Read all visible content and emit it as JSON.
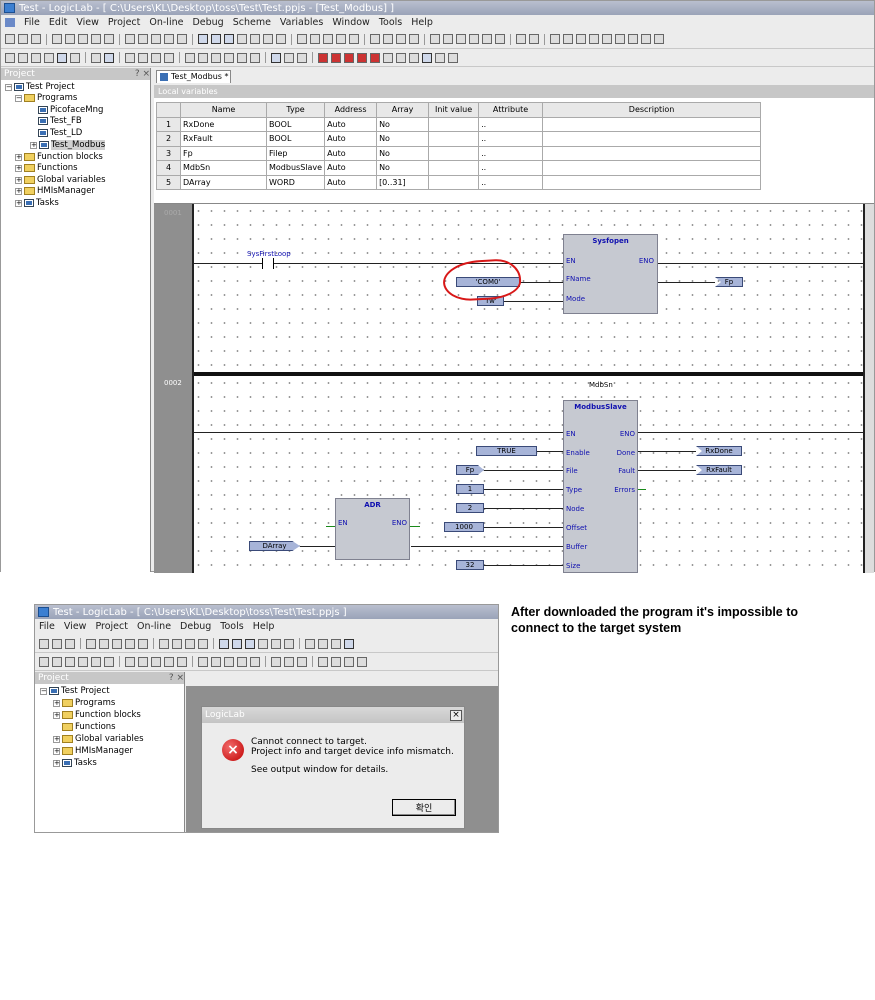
{
  "window1": {
    "title": "Test - LogicLab - [ C:\\Users\\KL\\Desktop\\toss\\Test\\Test.ppjs - [Test_Modbus] ]",
    "menu": [
      "File",
      "Edit",
      "View",
      "Project",
      "On-line",
      "Debug",
      "Scheme",
      "Variables",
      "Window",
      "Tools",
      "Help"
    ],
    "tab_label": "Test_Modbus *",
    "tree": {
      "header": "Project",
      "header_btns": "? ×",
      "items": [
        "Test Project",
        "Programs",
        "PicofaceMng",
        "Test_FB",
        "Test_LD",
        "Test_Modbus",
        "Function blocks",
        "Functions",
        "Global variables",
        "HMIsManager",
        "Tasks"
      ]
    },
    "vars_header_label": "Local variables",
    "vars_table": {
      "columns": [
        "",
        "Name",
        "Type",
        "Address",
        "Array",
        "Init value",
        "Attribute",
        "Description"
      ],
      "rows": [
        [
          "1",
          "RxDone",
          "BOOL",
          "Auto",
          "No",
          "",
          "..",
          ""
        ],
        [
          "2",
          "RxFault",
          "BOOL",
          "Auto",
          "No",
          "",
          "..",
          ""
        ],
        [
          "3",
          "Fp",
          "Filep",
          "Auto",
          "No",
          "",
          "..",
          ""
        ],
        [
          "4",
          "MdbSn",
          "ModbusSlave",
          "Auto",
          "No",
          "",
          "..",
          ""
        ],
        [
          "5",
          "DArray",
          "WORD",
          "Auto",
          "[0..31]",
          "",
          "..",
          ""
        ]
      ]
    },
    "network1": {
      "number": "0001",
      "contact_label": "SysFirstLoop",
      "block_title": "Sysfopen",
      "pins_left": [
        "EN",
        "FName",
        "Mode"
      ],
      "pins_right": [
        "ENO"
      ],
      "in_fname": "'COM0'",
      "in_mode": "'rw'",
      "out": "Fp",
      "highlight_color": "#d81818"
    },
    "network2": {
      "number": "0002",
      "instance": "MdbSn",
      "block_title": "ModbusSlave",
      "pins_left": [
        "EN",
        "Enable",
        "File",
        "Type",
        "Node",
        "Offset",
        "Buffer",
        "Size"
      ],
      "pins_right": [
        "ENO",
        "Done",
        "Fault",
        "Errors"
      ],
      "inputs": [
        "TRUE",
        "Fp",
        "1",
        "2",
        "1000",
        "32"
      ],
      "outputs": [
        "RxDone",
        "RxFault"
      ],
      "adr_title": "ADR",
      "adr_pins": [
        "EN",
        "ENO"
      ],
      "adr_in": "DArray"
    }
  },
  "caption": "After downloaded the program it's impossible to connect to the target system",
  "window2": {
    "title": "Test - LogicLab - [ C:\\Users\\KL\\Desktop\\toss\\Test\\Test.ppjs ]",
    "menu": [
      "File",
      "View",
      "Project",
      "On-line",
      "Debug",
      "Tools",
      "Help"
    ],
    "tree": {
      "header": "Project",
      "header_btns": "? ×",
      "items": [
        "Test Project",
        "Programs",
        "Function blocks",
        "Functions",
        "Global variables",
        "HMIsManager",
        "Tasks"
      ]
    },
    "dialog": {
      "title": "LogicLab",
      "close": "×",
      "line1": "Cannot connect to target.",
      "line2": "Project info and target device info mismatch.",
      "line3": "See output window for details.",
      "ok_label": "확인",
      "icon": "error-icon"
    }
  }
}
